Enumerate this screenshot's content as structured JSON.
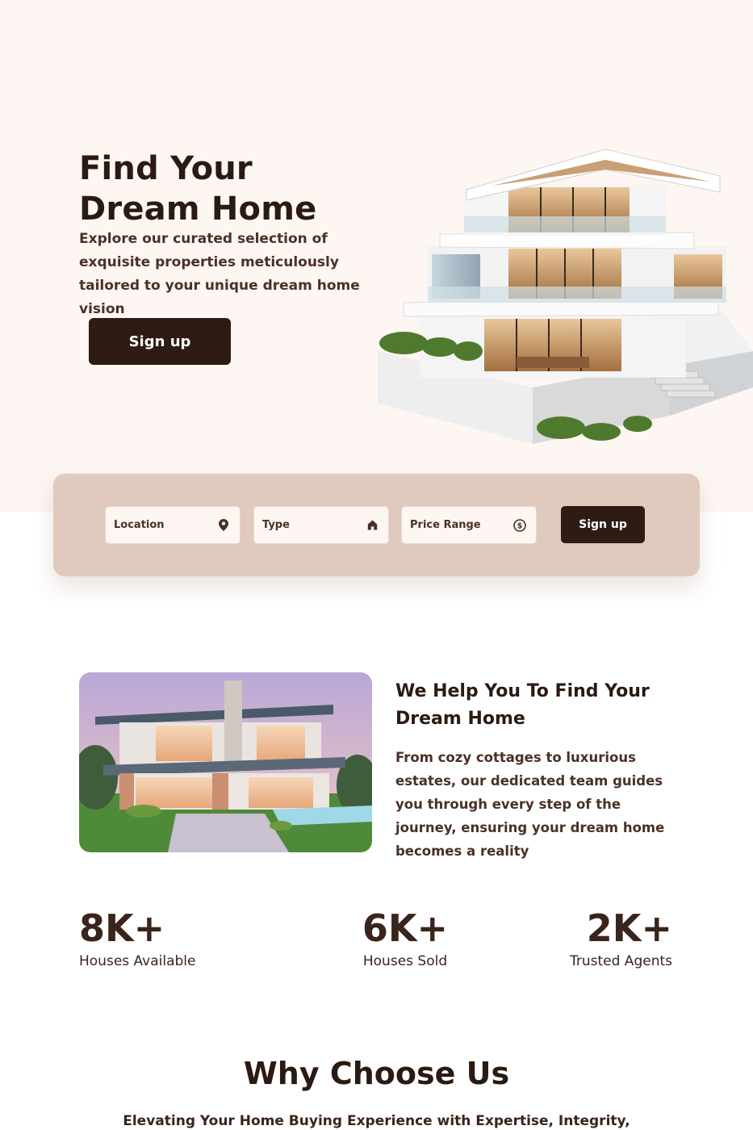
{
  "hero": {
    "title_line1": "Find Your",
    "title_line2": "Dream Home",
    "subtitle": "Explore our curated selection of exquisite properties meticulously tailored to your unique dream home vision",
    "cta_label": "Sign up"
  },
  "search": {
    "location_placeholder": "Location",
    "type_placeholder": "Type",
    "price_placeholder": "Price Range",
    "submit_label": "Sign up"
  },
  "about": {
    "title": "We Help You To Find Your Dream Home",
    "text": "From cozy cottages to luxurious estates, our dedicated team guides you through every step of the journey, ensuring your dream home becomes a reality"
  },
  "stats": [
    {
      "value": "8K+",
      "label": "Houses Available"
    },
    {
      "value": "6K+",
      "label": "Houses Sold"
    },
    {
      "value": "2K+",
      "label": "Trusted Agents"
    }
  ],
  "why": {
    "title": "Why Choose Us",
    "subtitle": "Elevating Your Home Buying Experience with Expertise, Integrity,"
  },
  "colors": {
    "dark_brown": "#2d1b14",
    "hero_bg": "#fdf6f2",
    "search_bg": "#e0c9bd",
    "text_brown": "#4a3128"
  },
  "icons": {
    "location": "map-pin-icon",
    "type": "home-icon",
    "price": "dollar-coin-icon"
  }
}
